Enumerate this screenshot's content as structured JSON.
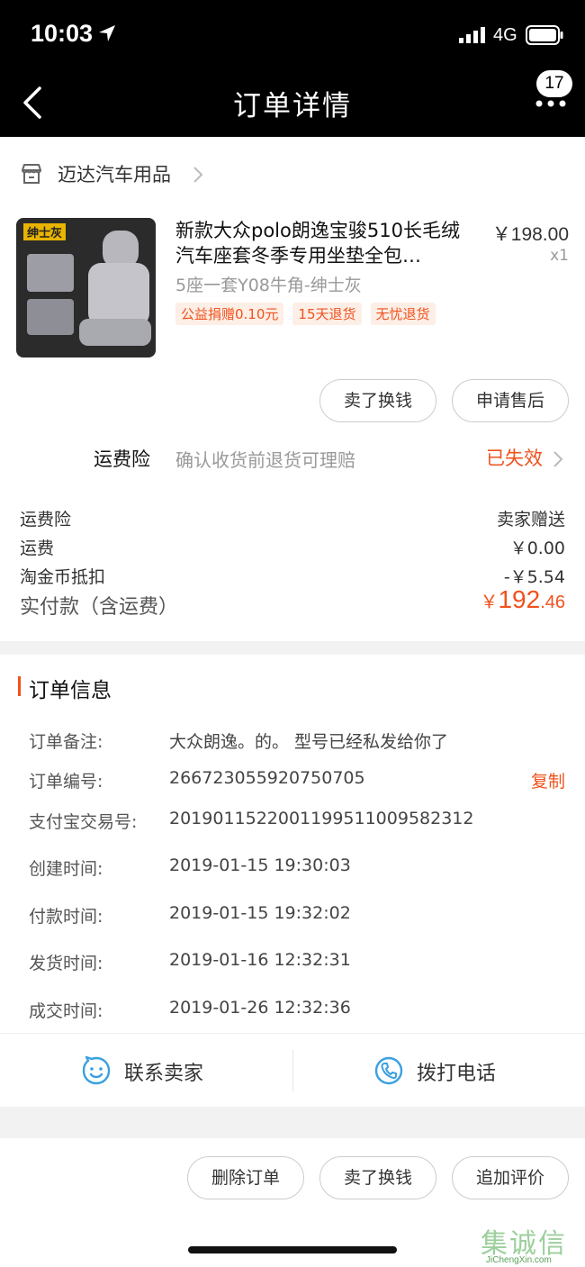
{
  "status_bar": {
    "time": "10:03",
    "network": "4G"
  },
  "nav": {
    "title": "订单详情",
    "badge": "17"
  },
  "store": {
    "name": "迈达汽车用品"
  },
  "product": {
    "image_label": "绅士灰",
    "title": "新款大众polo朗逸宝骏510长毛绒汽车座套冬季专用坐垫全包…",
    "price": "￥198.00",
    "quantity": "x1",
    "sku": "5座一套Y08牛角-绅士灰",
    "tags": [
      "公益捐赠0.10元",
      "15天退货",
      "无忧退货"
    ]
  },
  "item_actions": {
    "sell": "卖了换钱",
    "after_sale": "申请售后"
  },
  "insurance": {
    "label": "运费险",
    "desc": "确认收货前退货可理赔",
    "status": "已失效"
  },
  "fees": [
    {
      "label": "运费险",
      "value": "卖家赠送"
    },
    {
      "label": "运费",
      "value": "￥0.00"
    },
    {
      "label": "淘金币抵扣",
      "value": "-￥5.54"
    }
  ],
  "paid": {
    "label": "实付款（含运费）",
    "currency": "￥",
    "integer": "192",
    "decimal": ".46"
  },
  "order_info": {
    "title": "订单信息",
    "rows": [
      {
        "label": "订单备注:",
        "value": "大众朗逸。的。 型号已经私发给你了"
      },
      {
        "label": "订单编号:",
        "value": "266723055920750705",
        "action": "复制"
      },
      {
        "label": "支付宝交易号:",
        "value": "2019011522001199511009582312"
      },
      {
        "label": "创建时间:",
        "value": "2019-01-15 19:30:03"
      },
      {
        "label": "付款时间:",
        "value": "2019-01-15 19:32:02"
      },
      {
        "label": "发货时间:",
        "value": "2019-01-16 12:32:31"
      },
      {
        "label": "成交时间:",
        "value": "2019-01-26 12:32:36"
      }
    ]
  },
  "contact": {
    "seller": "联系卖家",
    "phone": "拨打电话"
  },
  "bottom_actions": {
    "delete": "删除订单",
    "sell": "卖了换钱",
    "review": "追加评价"
  },
  "watermark": {
    "text": "集诚信",
    "sub": "JiChengXin.com"
  },
  "colors": {
    "accent": "#f0521d",
    "icon_blue": "#3aa0e0",
    "tag_bg": "#fdeee6"
  }
}
